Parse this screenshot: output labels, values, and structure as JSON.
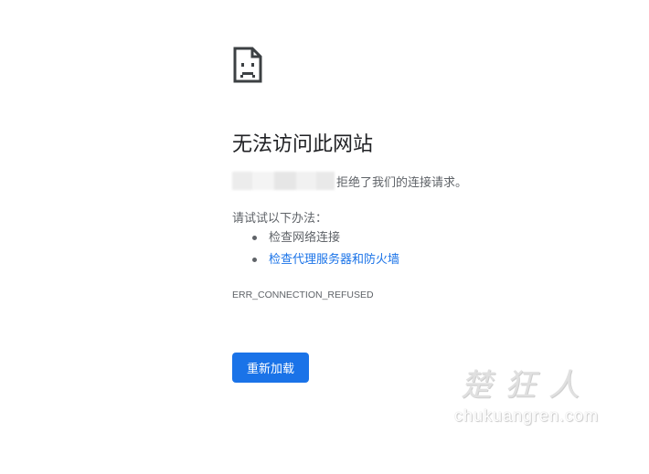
{
  "icons": {
    "sad_page": "sad-page-icon"
  },
  "error": {
    "title": "无法访问此网站",
    "refused_message": "拒绝了我们的连接请求。",
    "suggestions_label": "请试试以下办法：",
    "suggestions": [
      {
        "label": "检查网络连接",
        "link": false
      },
      {
        "label": "检查代理服务器和防火墙",
        "link": true
      }
    ],
    "code": "ERR_CONNECTION_REFUSED"
  },
  "actions": {
    "reload_label": "重新加载"
  },
  "watermark": {
    "cn": "楚狂人",
    "en": "chukuangren.com"
  },
  "colors": {
    "accent": "#1a73e8",
    "text_primary": "#202124",
    "text_secondary": "#5f6368",
    "icon": "#3c4043"
  }
}
